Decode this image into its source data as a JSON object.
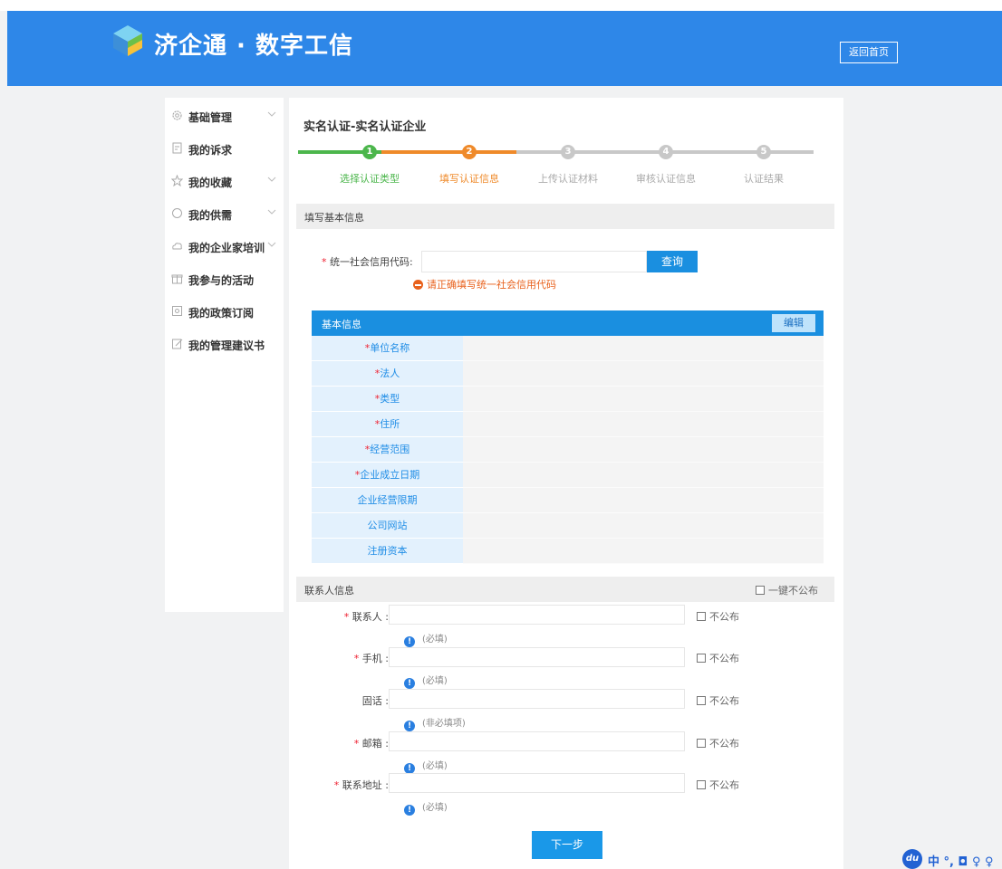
{
  "header": {
    "brand": "济企通 · 数字工信",
    "home_button": "返回首页"
  },
  "sidebar": {
    "items": [
      {
        "label": "基础管理",
        "icon": "gear-icon",
        "has_chevron": true
      },
      {
        "label": "我的诉求",
        "icon": "document-icon",
        "has_chevron": false
      },
      {
        "label": "我的收藏",
        "icon": "star-icon",
        "has_chevron": true
      },
      {
        "label": "我的供需",
        "icon": "circle-icon",
        "has_chevron": true
      },
      {
        "label": "我的企业家培训",
        "icon": "cloud-icon",
        "has_chevron": true
      },
      {
        "label": "我参与的活动",
        "icon": "gift-icon",
        "has_chevron": false
      },
      {
        "label": "我的政策订阅",
        "icon": "subscription-icon",
        "has_chevron": false
      },
      {
        "label": "我的管理建议书",
        "icon": "edit-note-icon",
        "has_chevron": false
      }
    ]
  },
  "main": {
    "title": "实名认证-实名认证企业",
    "steps": [
      {
        "num": "1",
        "label": "选择认证类型",
        "state": "done"
      },
      {
        "num": "2",
        "label": "填写认证信息",
        "state": "active"
      },
      {
        "num": "3",
        "label": "上传认证材料",
        "state": "pending"
      },
      {
        "num": "4",
        "label": "审核认证信息",
        "state": "pending"
      },
      {
        "num": "5",
        "label": "认证结果",
        "state": "pending"
      }
    ],
    "basic_section_title": "填写基本信息",
    "credit_code_label": "统一社会信用代码:",
    "credit_code_value": "",
    "query_button": "查询",
    "credit_error": "请正确填写统一社会信用代码",
    "info_header": "基本信息",
    "edit_button": "编辑",
    "info_rows": [
      {
        "label": "单位名称",
        "required": true,
        "value": ""
      },
      {
        "label": "法人",
        "required": true,
        "value": ""
      },
      {
        "label": "类型",
        "required": true,
        "value": ""
      },
      {
        "label": "住所",
        "required": true,
        "value": ""
      },
      {
        "label": "经营范围",
        "required": true,
        "value": ""
      },
      {
        "label": "企业成立日期",
        "required": true,
        "value": ""
      },
      {
        "label": "企业经营限期",
        "required": false,
        "value": ""
      },
      {
        "label": "公司网站",
        "required": false,
        "value": ""
      },
      {
        "label": "注册资本",
        "required": false,
        "value": ""
      }
    ],
    "contact_section_title": "联系人信息",
    "publish_all_label": "一键不公布",
    "contact_fields": [
      {
        "label": "联系人 :",
        "required": true,
        "value": "",
        "publish_label": "不公布",
        "hint": "(必填)"
      },
      {
        "label": "手机 :",
        "required": true,
        "value": "",
        "publish_label": "不公布",
        "hint": "(必填)"
      },
      {
        "label": "固话 :",
        "required": false,
        "value": "",
        "publish_label": "不公布",
        "hint": "(非必填项)"
      },
      {
        "label": "邮箱 :",
        "required": true,
        "value": "",
        "publish_label": "不公布",
        "hint": "(必填)"
      },
      {
        "label": "联系地址 :",
        "required": true,
        "value": "",
        "publish_label": "不公布",
        "hint": "(必填)"
      }
    ],
    "next_button": "下一步"
  },
  "toolbar_widget": {
    "logo_text": "du",
    "text": "中 °, ◘ ♀ ♀"
  },
  "colors": {
    "header_blue": "#2e87e8",
    "primary_blue": "#1a8fe0",
    "step_done": "#4cb64c",
    "step_active": "#ef8a2a",
    "step_pending": "#c8c8c8",
    "error": "#e8611c"
  }
}
